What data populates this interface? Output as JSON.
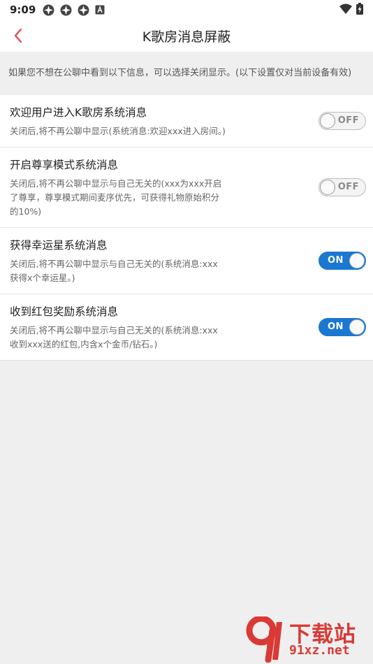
{
  "status_bar": {
    "time": "9:09",
    "left_icons": [
      "app-notification-icon",
      "app-notification-icon",
      "app-notification-icon",
      "font-a-icon"
    ],
    "right_icons": [
      "wifi-icon",
      "battery-icon"
    ]
  },
  "header": {
    "back_icon": "chevron-left-icon",
    "title": "K歌房消息屏蔽",
    "accent_color": "#e8465a"
  },
  "notice": "如果您不想在公聊中看到以下信息，可以选择关闭显示。(以下设置仅对当前设备有效)",
  "settings": [
    {
      "title": "欢迎用户进入K歌房系统消息",
      "desc": "关闭后,将不再公聊中显示(系统消息:欢迎xxx进入房间。)",
      "state": "off",
      "toggle_label": "OFF"
    },
    {
      "title": "开启尊享模式系统消息",
      "desc": "关闭后,将不再公聊中显示与自己无关的(xxx为xxx开启了尊享，尊享模式期间麦序优先，可获得礼物原始积分的10%)",
      "state": "off",
      "toggle_label": "OFF"
    },
    {
      "title": "获得幸运星系统消息",
      "desc": "关闭后,将不再公聊中显示与自己无关的(系统消息:xxx获得x个幸运星。)",
      "state": "on",
      "toggle_label": "ON"
    },
    {
      "title": "收到红包奖励系统消息",
      "desc": "关闭后,将不再公聊中显示与自己无关的(系统消息:xxx收到xxx送的红包,内含x个金币/钻石。)",
      "state": "on",
      "toggle_label": "ON"
    }
  ],
  "watermark": {
    "top": "下载站",
    "bottom": "91xz.net",
    "color": "#d93a35"
  }
}
